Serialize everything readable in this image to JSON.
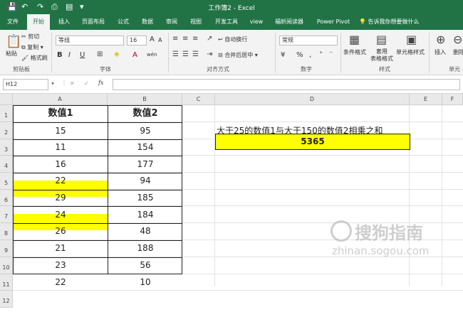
{
  "window": {
    "title": "工作簿2 - Excel",
    "quick_access": [
      "💾",
      "↶",
      "↷",
      "⎙",
      "▤",
      "▾"
    ]
  },
  "tabs": [
    {
      "label": "文件",
      "active": false
    },
    {
      "label": "开始",
      "active": true
    },
    {
      "label": "插入",
      "active": false
    },
    {
      "label": "页面布局",
      "active": false
    },
    {
      "label": "公式",
      "active": false
    },
    {
      "label": "数据",
      "active": false
    },
    {
      "label": "审阅",
      "active": false
    },
    {
      "label": "视图",
      "active": false
    },
    {
      "label": "开发工具",
      "active": false
    },
    {
      "label": "view",
      "active": false
    },
    {
      "label": "福昕阅读器",
      "active": false
    },
    {
      "label": "Power Pivot",
      "active": false
    }
  ],
  "tell_me": "告诉我你想要做什么",
  "ribbon": {
    "clipboard": {
      "label": "剪贴板",
      "paste": "粘贴",
      "cut": "剪切",
      "copy": "复制",
      "format_painter": "格式刷"
    },
    "font": {
      "label": "字体",
      "font_name": "等线",
      "font_size": "16",
      "grow": "A",
      "shrink": "A",
      "bold": "B",
      "italic": "I",
      "underline": "U",
      "color_a": "A",
      "wen": "wén"
    },
    "alignment": {
      "label": "对齐方式",
      "wrap": "自动换行",
      "merge": "合并后居中"
    },
    "number": {
      "label": "数字",
      "format": "常规",
      "currency": "¥",
      "percent": "%",
      "comma": ","
    },
    "styles": {
      "label": "样式",
      "conditional": "条件格式",
      "table": "套用\n表格格式",
      "cell": "单元格样式"
    },
    "cells": {
      "label": "单元",
      "insert": "插入",
      "delete": "删除"
    }
  },
  "formula_bar": {
    "name_box": "H12",
    "fx": "fx",
    "cancel": "✕",
    "enter": "✓",
    "value": ""
  },
  "columns": [
    "A",
    "B",
    "C",
    "D",
    "E",
    "F"
  ],
  "rows": [
    "1",
    "2",
    "3",
    "4",
    "5",
    "6",
    "7",
    "8",
    "9",
    "10",
    "11",
    "12"
  ],
  "table": {
    "headers": [
      "数值1",
      "数值2"
    ],
    "rows": [
      [
        "15",
        "95"
      ],
      [
        "11",
        "154"
      ],
      [
        "16",
        "177"
      ],
      [
        "22",
        "94"
      ],
      [
        "29",
        "185"
      ],
      [
        "24",
        "184"
      ],
      [
        "26",
        "48"
      ],
      [
        "21",
        "188"
      ],
      [
        "23",
        "56"
      ],
      [
        "22",
        "10"
      ]
    ]
  },
  "d2_text": "大于25的数值1与大于150的数值2相乘之和",
  "d3_value": "5365",
  "watermark": {
    "brand": "搜狗指南",
    "url": "zhinan.sogou.com"
  },
  "colors": {
    "excel_green": "#217346",
    "highlight": "#ffff00"
  }
}
